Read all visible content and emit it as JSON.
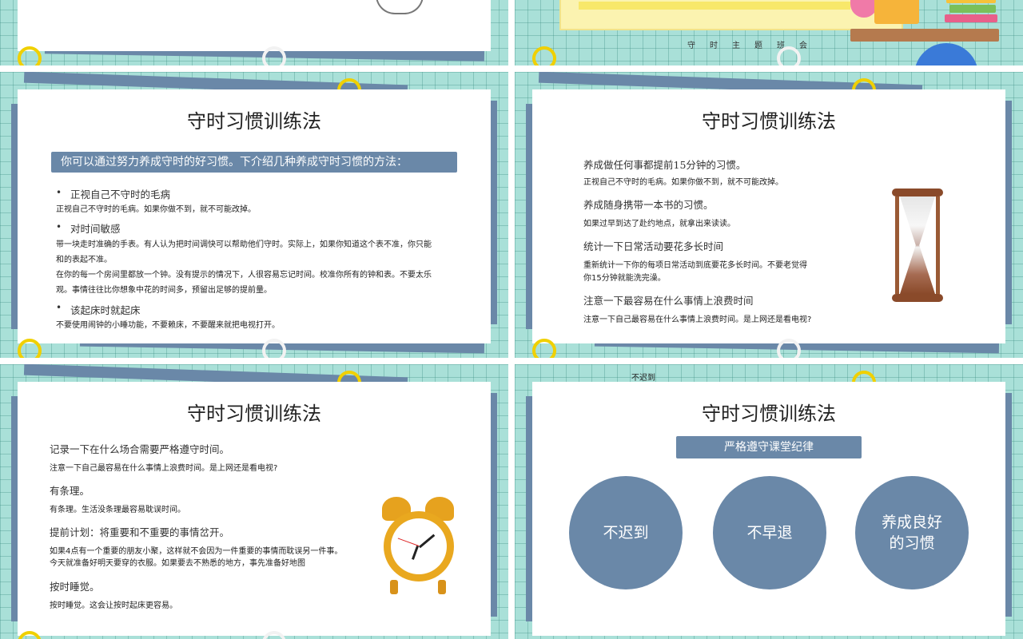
{
  "slide2": {
    "mini_title": "守时主题班会"
  },
  "slide3": {
    "title": "守时习惯训练法",
    "intro": "你可以通过努力养成守时的好习惯。下介绍几种养成守时习惯的方法：",
    "items": [
      {
        "heading": "正视自己不守时的毛病",
        "lines": [
          "正视自己不守时的毛病。如果你做不到，就不可能改掉。"
        ]
      },
      {
        "heading": "对时间敏感",
        "lines": [
          "带一块走时准确的手表。有人认为把时间调快可以帮助他们守时。实际上，如果你知道这个表不准，你只能",
          "和的表起不准。",
          "在你的每一个房间里都放一个钟。没有提示的情况下，人很容易忘记时间。校准你所有的钟和表。不要太乐",
          "观。事情往往比你想象中花的时间多，预留出足够的提前量。"
        ]
      },
      {
        "heading": "该起床时就起床",
        "lines": [
          "不要使用闹钟的小睡功能，不要赖床，不要醒来就把电视打开。"
        ]
      }
    ]
  },
  "slide4": {
    "title": "守时习惯训练法",
    "items": [
      {
        "heading": "养成做任何事都提前15分钟的习惯。",
        "lines": [
          "正视自己不守时的毛病。如果你做不到，就不可能改掉。"
        ]
      },
      {
        "heading": "养成随身携带一本书的习惯。",
        "lines": [
          "如果过早到达了赴约地点，就拿出来读读。"
        ]
      },
      {
        "heading": "统计一下日常活动要花多长时间",
        "lines": [
          "重新统计一下你的每项日常活动到底要花多长时间。不要老觉得",
          "你15分钟就能洗完澡。"
        ]
      },
      {
        "heading": "注意一下最容易在什么事情上浪费时间",
        "lines": [
          "注意一下自己最容易在什么事情上浪费时间。是上网还是看电视?"
        ]
      }
    ]
  },
  "slide5": {
    "title": "守时习惯训练法",
    "items": [
      {
        "heading": "记录一下在什么场合需要严格遵守时间。",
        "lines": [
          "注意一下自己最容易在什么事情上浪费时间。是上网还是看电视?"
        ]
      },
      {
        "heading": "有条理。",
        "lines": [
          "有条理。生活没条理最容易耽误时间。"
        ]
      },
      {
        "heading": "提前计划：将重要和不重要的事情岔开。",
        "lines": [
          "如果4点有一个重要的朋友小聚，这样就不会因为一件重要的事情而耽误另一件事。",
          "今天就准备好明天要穿的衣服。如果要去不熟悉的地方，事先准备好地图"
        ]
      },
      {
        "heading": "按时睡觉。",
        "lines": [
          "按时睡觉。这会让按时起床更容易。"
        ]
      }
    ]
  },
  "slide6": {
    "top_note": "不迟到",
    "title": "守时习惯训练法",
    "subtitle": "严格遵守课堂纪律",
    "circles": [
      "不迟到",
      "不早退",
      "养成良好\n的习惯"
    ]
  },
  "colors": {
    "accent": "#6a88a8",
    "grid_bg": "#a9e0d8",
    "ring": "#f0d000"
  }
}
